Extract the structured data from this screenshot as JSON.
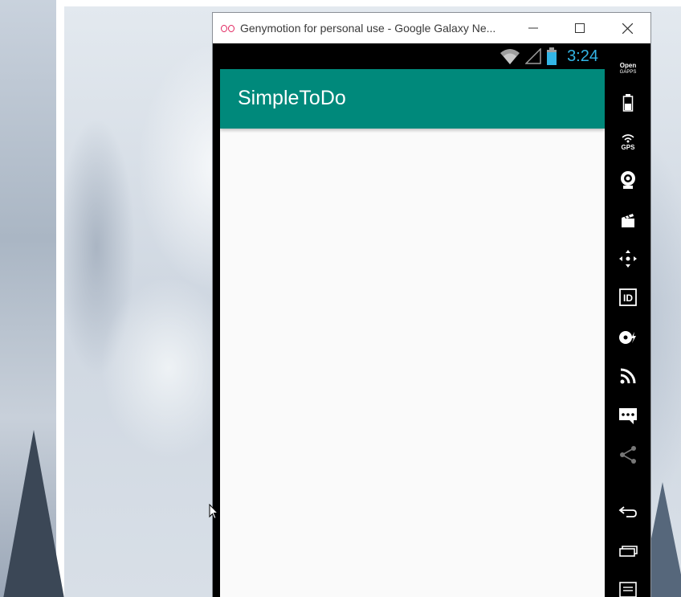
{
  "window": {
    "title": "Genymotion for personal use - Google Galaxy Ne...",
    "logo_icon": "genymotion-logo-icon",
    "controls": [
      "minimize-icon",
      "maximize-icon",
      "close-icon"
    ]
  },
  "status_bar": {
    "time": "3:24",
    "icons": [
      "wifi-icon",
      "signal-icon",
      "battery-icon"
    ],
    "clock_color": "#33b5e5"
  },
  "app": {
    "title": "SimpleToDo",
    "bar_color": "#00897b",
    "background_color": "#fafafa"
  },
  "sidebar": {
    "open_gapps": {
      "line1": "Open",
      "line2": "GAPPS"
    },
    "gps_label": "GPS",
    "id_label": "ID",
    "tools": [
      "open-gapps-button",
      "battery-tool-icon",
      "gps-tool-icon",
      "webcam-tool-icon",
      "screencast-tool-icon",
      "move-tool-icon",
      "device-id-tool-icon",
      "disk-io-tool-icon",
      "network-tool-icon",
      "sms-tool-icon",
      "share-tool-icon",
      "back-nav-icon",
      "recents-nav-icon",
      "menu-nav-icon"
    ]
  }
}
